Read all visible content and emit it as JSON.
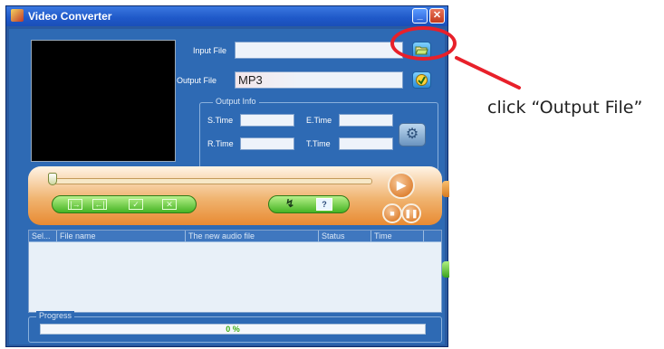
{
  "window": {
    "title": "Video Converter",
    "min_symbol": "_",
    "close_symbol": "✕"
  },
  "input": {
    "label": "Input File",
    "value": "",
    "browse_icon": "folder-open-icon"
  },
  "output": {
    "label": "Output File",
    "value": "MP3",
    "icon": "output-settings-icon"
  },
  "output_info": {
    "title": "Output Info",
    "s_time_label": "S.Time",
    "e_time_label": "E.Time",
    "r_time_label": "R.Time",
    "t_time_label": "T.Time",
    "s_time": "",
    "e_time": "",
    "r_time": "",
    "t_time": ""
  },
  "list": {
    "columns": [
      "Sel...",
      "File name",
      "The new audio file",
      "Status",
      "Time"
    ],
    "rows": []
  },
  "progress": {
    "label": "Progress",
    "text": "0 %",
    "value": 0
  },
  "annotation": {
    "text": "click “Output File”",
    "color": "#e8202a"
  }
}
